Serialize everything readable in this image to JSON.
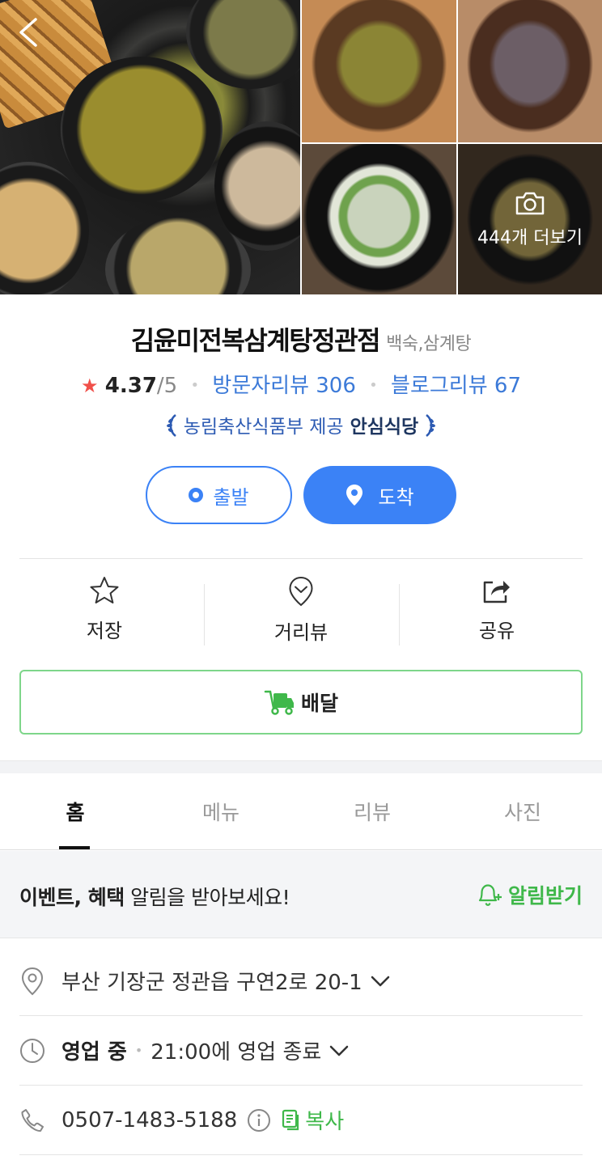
{
  "photos": {
    "more_label": "444개 더보기"
  },
  "store": {
    "name": "김윤미전복삼계탕정관점",
    "category": "백숙,삼계탕",
    "rating": "4.37",
    "rating_max": "/5",
    "visitor_reviews_label": "방문자리뷰 306",
    "blog_reviews_label": "블로그리뷰 67",
    "cert_provider": "농림축산식품부 제공",
    "cert_name": "안심식당"
  },
  "route": {
    "depart_label": "출발",
    "arrive_label": "도착"
  },
  "actions": [
    {
      "label": "저장",
      "icon": "star-outline-icon"
    },
    {
      "label": "거리뷰",
      "icon": "street-view-pin-icon"
    },
    {
      "label": "공유",
      "icon": "share-icon"
    }
  ],
  "delivery": {
    "label": "배달",
    "icon": "delivery-truck-icon",
    "color": "#3fb84a"
  },
  "tabs": [
    {
      "label": "홈",
      "active": true
    },
    {
      "label": "메뉴",
      "active": false
    },
    {
      "label": "리뷰",
      "active": false
    },
    {
      "label": "사진",
      "active": false
    }
  ],
  "notify": {
    "bold_text": "이벤트, 혜택",
    "text": " 알림을 받아보세요!",
    "button_label": "알림받기"
  },
  "info": {
    "address": "부산 기장군 정관읍 구연2로 20-1",
    "status": "영업 중",
    "hours": "21:00에 영업 종료",
    "phone": "0507-1483-5188",
    "copy_label": "복사"
  },
  "colors": {
    "primary_blue": "#3b82f6",
    "link_blue": "#3c7ad8",
    "accent_green": "#3fb84a",
    "star_red": "#f0504a"
  }
}
